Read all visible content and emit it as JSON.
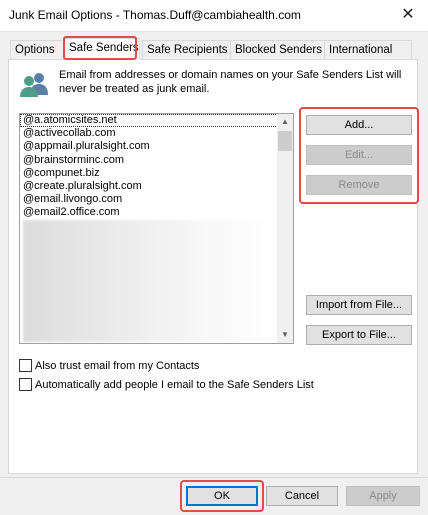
{
  "window": {
    "title": "Junk Email Options - Thomas.Duff@cambiahealth.com",
    "close_glyph": "✕"
  },
  "tabs": [
    {
      "label": "Options"
    },
    {
      "label": "Safe Senders"
    },
    {
      "label": "Safe Recipients"
    },
    {
      "label": "Blocked Senders"
    },
    {
      "label": "International"
    }
  ],
  "active_tab": "Safe Senders",
  "description": "Email from addresses or domain names on your Safe Senders List will never be treated as junk email.",
  "safe_senders": [
    "@a.atomicsites.net",
    "@activecollab.com",
    "@appmail.pluralsight.com",
    "@brainstorminc.com",
    "@compunet.biz",
    "@create.pluralsight.com",
    "@email.livongo.com",
    "@email2.office.com"
  ],
  "buttons": {
    "add": "Add...",
    "edit": "Edit...",
    "remove": "Remove",
    "import": "Import from File...",
    "export": "Export to File..."
  },
  "checkboxes": {
    "trust_contacts": {
      "label": "Also trust email from my Contacts",
      "checked": false
    },
    "auto_add": {
      "label": "Automatically add people I email to the Safe Senders List",
      "checked": false
    }
  },
  "footer": {
    "ok": "OK",
    "cancel": "Cancel",
    "apply": "Apply"
  },
  "colors": {
    "highlight": "#e54b4b",
    "focus_blue": "#0078d7"
  },
  "icons": {
    "people": "people-icon",
    "close": "close-icon",
    "scroll_up": "scroll-up-arrow-icon",
    "scroll_down": "scroll-down-arrow-icon"
  }
}
